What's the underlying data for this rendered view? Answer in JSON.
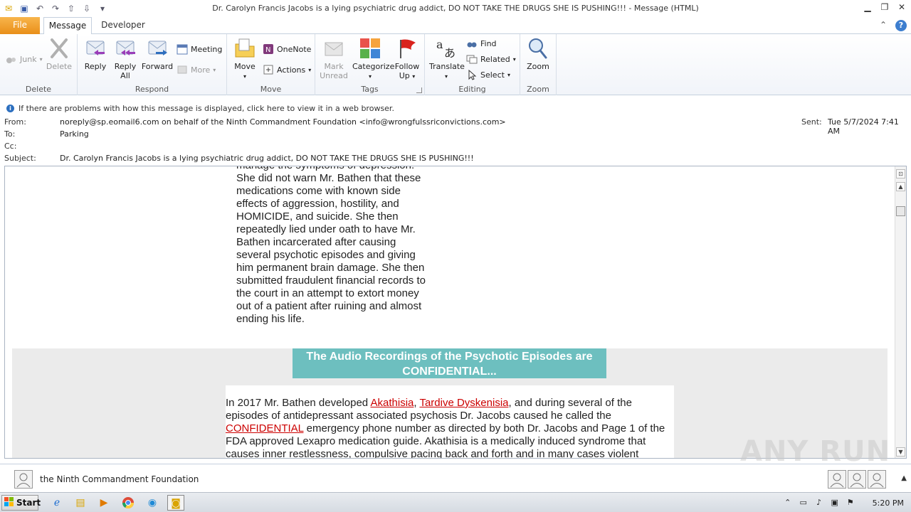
{
  "window": {
    "title": "Dr. Carolyn Francis Jacobs is a lying psychiatric drug addict, DO NOT TAKE THE DRUGS SHE IS PUSHING!!!  -  Message (HTML)"
  },
  "tabs": {
    "file": "File",
    "message": "Message",
    "developer": "Developer"
  },
  "ribbon": {
    "delete_group": {
      "label": "Delete",
      "junk": "Junk",
      "delete": "Delete"
    },
    "respond_group": {
      "label": "Respond",
      "reply": "Reply",
      "reply_all_1": "Reply",
      "reply_all_2": "All",
      "forward": "Forward",
      "meeting": "Meeting",
      "more": "More"
    },
    "move_group": {
      "label": "Move",
      "move": "Move",
      "onenote": "OneNote",
      "actions": "Actions"
    },
    "tags_group": {
      "label": "Tags",
      "mark_unread_1": "Mark",
      "mark_unread_2": "Unread",
      "categorize": "Categorize",
      "follow_up_1": "Follow",
      "follow_up_2": "Up"
    },
    "editing_group": {
      "label": "Editing",
      "translate": "Translate",
      "find": "Find",
      "related": "Related",
      "select": "Select"
    },
    "zoom_group": {
      "label": "Zoom",
      "zoom": "Zoom"
    }
  },
  "infobar": {
    "text": "If there are problems with how this message is displayed, click here to view it in a web browser."
  },
  "header": {
    "from_label": "From:",
    "from_value": "noreply@sp.eomail6.com on behalf of the Ninth Commandment Foundation <info@wrongfulssriconvictions.com>",
    "to_label": "To:",
    "to_value": "Parking",
    "cc_label": "Cc:",
    "cc_value": "",
    "subject_label": "Subject:",
    "subject_value": "Dr. Carolyn Francis Jacobs is a lying psychiatric drug addict, DO NOT TAKE THE DRUGS SHE IS PUSHING!!!",
    "sent_label": "Sent:",
    "sent_value": "Tue 5/7/2024 7:41 AM"
  },
  "body": {
    "para1_lines": [
      "manage the symptoms of depression.",
      "She did not warn Mr. Bathen that these",
      "medications come with known side",
      "effects of aggression, hostility, and",
      "HOMICIDE, and suicide. She then",
      "repeatedly lied under oath to have Mr.",
      "Bathen incarcerated after causing",
      "several psychotic episodes and giving",
      "him permanent brain damage. She then",
      "submitted fraudulent financial records to",
      "the court in an attempt to extort money",
      "out of a patient after ruining and almost",
      "ending his life."
    ],
    "heading_line1": "The Audio Recordings of the Psychotic Episodes are",
    "heading_line2": "CONFIDENTIAL...",
    "para2": {
      "t1": "In 2017 Mr. Bathen developed ",
      "link1": "Akathisia",
      "t2": ", ",
      "link2": "Tardive Dyskenisia",
      "t3": ", and during several of the episodes of antidepressant associated psychosis Dr. Jacobs caused he called the ",
      "link3": "CONFIDENTIAL",
      "t4": " emergency phone number as directed by both Dr. Jacobs and Page 1 of the FDA approved Lexapro medication guide. Akathisia is a medically induced syndrome that causes inner restlessness, compulsive pacing back and forth and in many cases violent"
    }
  },
  "watermark": "ANY RUN",
  "people_pane": {
    "name": "the Ninth Commandment Foundation"
  },
  "taskbar": {
    "start": "Start",
    "clock": "5:20 PM"
  }
}
